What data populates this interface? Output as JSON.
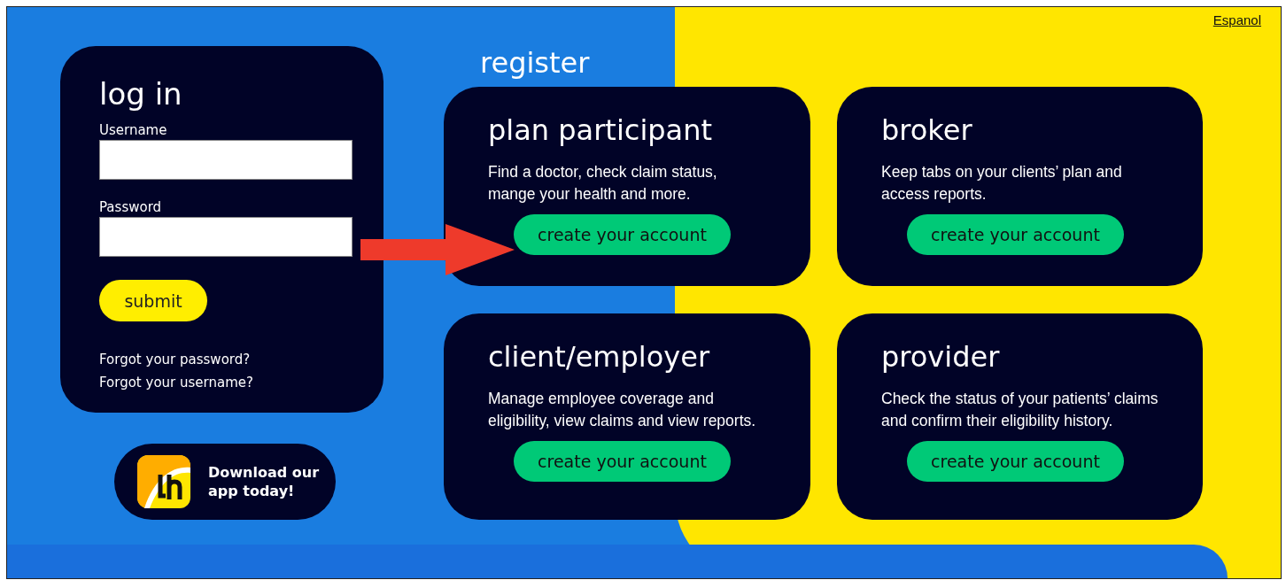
{
  "language_link": "Espanol",
  "login": {
    "title": "log in",
    "fields": [
      {
        "label": "Username"
      },
      {
        "label": "Password"
      }
    ],
    "submit": "submit",
    "links": [
      "Forgot your password?",
      "Forgot your username?"
    ]
  },
  "app_banner": {
    "text": "Download our app today!"
  },
  "register": {
    "title": "register",
    "cards": [
      {
        "title": "plan participant",
        "description": "Find a doctor, check claim status, mange your health and more.",
        "button": "create your account"
      },
      {
        "title": "broker",
        "description": "Keep tabs on your clients’ plan and access reports.",
        "button": "create your account"
      },
      {
        "title": "client/employer",
        "description": "Manage employee coverage and eligibility, view claims and view reports.",
        "button": "create your account"
      },
      {
        "title": "provider",
        "description": "Check the status of your patients’ claims and confirm their eligibility history.",
        "button": "create your account"
      }
    ]
  }
}
